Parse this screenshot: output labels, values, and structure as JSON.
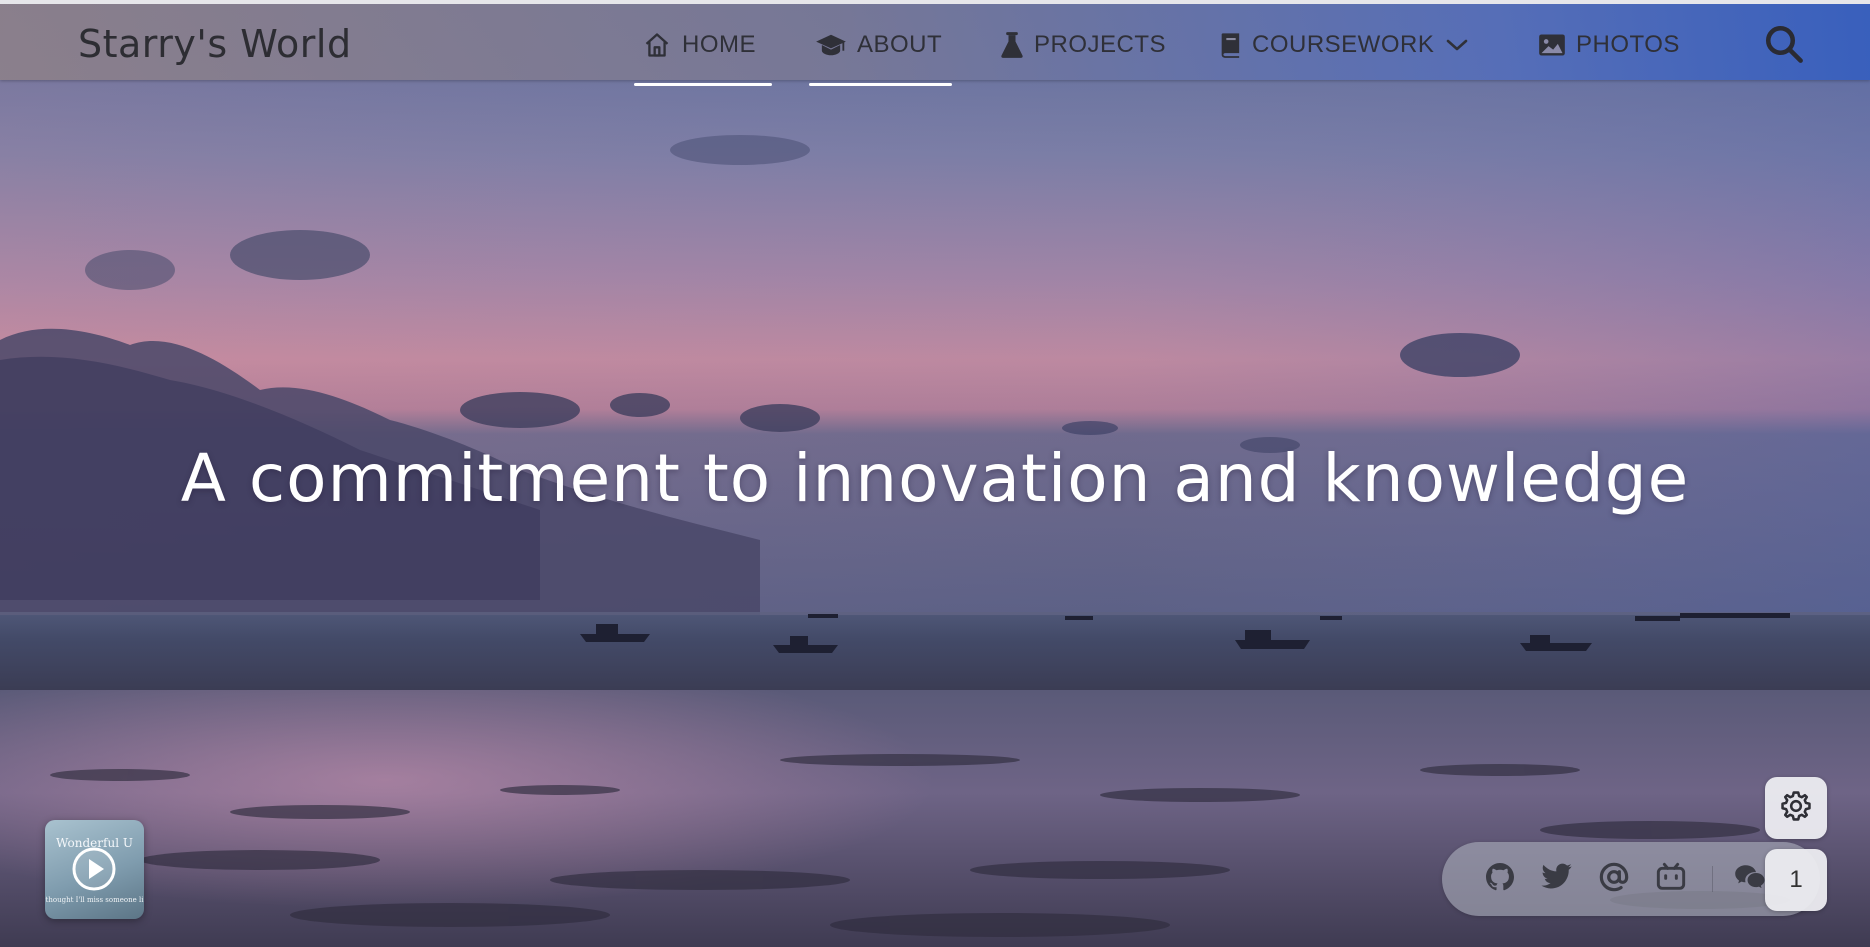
{
  "site": {
    "brand": "Starry's World"
  },
  "nav": {
    "items": [
      {
        "label": "HOME",
        "icon": "home-icon"
      },
      {
        "label": "ABOUT",
        "icon": "graduation-cap-icon"
      },
      {
        "label": "PROJECTS",
        "icon": "flask-icon"
      },
      {
        "label": "COURSEWORK",
        "icon": "book-icon"
      },
      {
        "label": "PHOTOS",
        "icon": "image-icon"
      }
    ],
    "active": [
      "HOME",
      "ABOUT"
    ],
    "search_icon": "search-icon"
  },
  "hero": {
    "title": "A commitment to innovation and knowledge"
  },
  "player": {
    "title": "Wonderful U",
    "subtitle": "thought I'll miss someone li"
  },
  "social": {
    "icons": [
      "github-icon",
      "twitter-icon",
      "email-at-icon",
      "bilibili-icon",
      "wechat-icon"
    ]
  },
  "counter": {
    "value": "1"
  },
  "colors": {
    "nav_text": "#2f3038",
    "nav_gradient_end": "#375fbe",
    "hero_text": "#ffffff"
  }
}
